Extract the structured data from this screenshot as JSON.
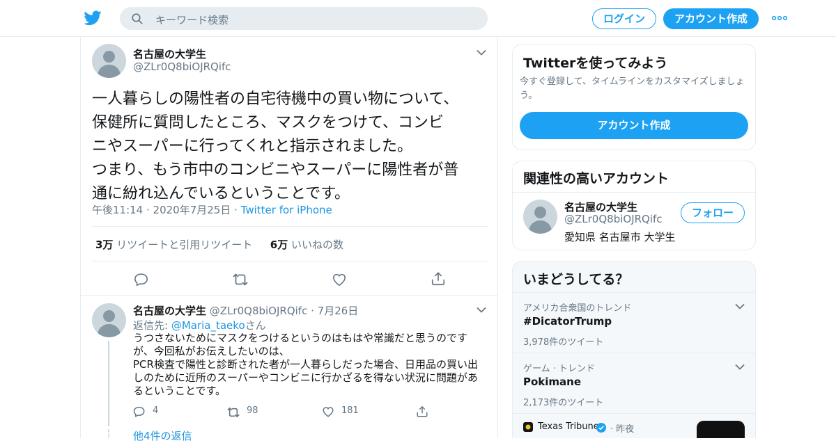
{
  "colors": {
    "accent": "#1da1f2",
    "link": "#1b95e0",
    "muted": "#657786",
    "border": "#e6ecf0"
  },
  "header": {
    "logo_icon": "twitter-bird-icon",
    "search_placeholder": "キーワード検索",
    "login_label": "ログイン",
    "signup_label": "アカウント作成",
    "more_icon": "more-dots-icon"
  },
  "tweet": {
    "name": "名古屋の大学生",
    "handle": "@ZLr0Q8biOJRQifc",
    "text_lines": [
      "一人暮らしの陽性者の自宅待機中の買い物について、",
      "保健所に質問したところ、マスクをつけて、コンビ",
      "ニやスーパーに行ってくれと指示されました。",
      "つまり、もう市中のコンビニやスーパーに陽性者が普",
      "通に紛れ込んでいるということです。"
    ],
    "time": "午後11:14",
    "date": "2020年7月25日",
    "source": "Twitter for iPhone",
    "retweets_count": "3万",
    "retweets_label": "リツイートと引用リツイート",
    "likes_count": "6万",
    "likes_label": "いいねの数"
  },
  "reply": {
    "name": "名古屋の大学生",
    "handle": "@ZLr0Q8biOJRQifc",
    "date": "7月26日",
    "reply_to_prefix": "返信先: ",
    "reply_to_user": "@Maria_taeko",
    "reply_to_suffix": "さん",
    "text_lines": [
      "うつさないためにマスクをつけるというのはもはや常識だと思うのです",
      "が、今回私がお伝えしたいのは、",
      "PCR検査で陽性と診断された者が一人暮らしだった場合、日用品の買い出",
      "しのために近所のスーパーやコンビニに行かざるを得ない状況に問題があ",
      "るということです。"
    ],
    "reply_count": "4",
    "retweet_count": "98",
    "like_count": "181",
    "show_more": "他4件の返信"
  },
  "sidebar": {
    "signup_card": {
      "title": "Twitterを使ってみよう",
      "subtitle_lines": [
        "今すぐ登録して、タイムラインをカスタマイズしましょ",
        "う。"
      ],
      "button": "アカウント作成"
    },
    "related": {
      "title": "関連性の高いアカウント",
      "name": "名古屋の大学生",
      "handle": "@ZLr0Q8biOJRQifc",
      "bio": "愛知県 名古屋市 大学生",
      "follow": "フォロー"
    },
    "trends": {
      "title": "いまどうしてる？",
      "items": [
        {
          "context": "アメリカ合衆国のトレンド",
          "name": "#DicatorTrump",
          "count": "3,978件のツイート"
        },
        {
          "context": "ゲーム · トレンド",
          "name": "Pokimane",
          "count": "2,173件のツイート"
        }
      ],
      "news": {
        "source": "Texas Tribune",
        "time": "昨夜"
      }
    }
  }
}
